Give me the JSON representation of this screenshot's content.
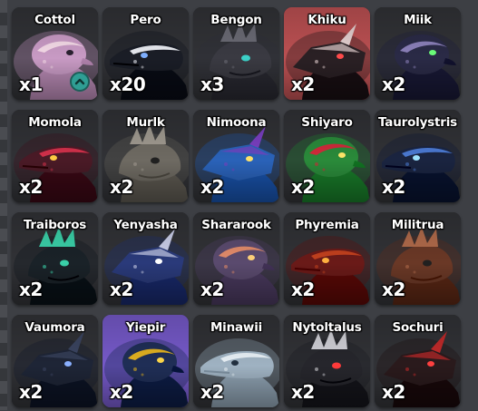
{
  "inventory": {
    "items": [
      {
        "name": "Cottol",
        "qty": "x1",
        "icon": "cottol-portrait-icon",
        "bg": "#2b2c30",
        "body": "#c89ac4",
        "accent": "#f3d9e6",
        "eye": "#2a2030",
        "badge": "upgrade-badge-icon"
      },
      {
        "name": "Pero",
        "qty": "x20",
        "icon": "pero-portrait-icon",
        "bg": "#2b2c30",
        "body": "#1a1d26",
        "accent": "#e6e8ee",
        "eye": "#7fb0ff"
      },
      {
        "name": "Bengon",
        "qty": "x3",
        "icon": "bengon-portrait-icon",
        "bg": "#2b2c30",
        "body": "#3a3a42",
        "accent": "#6a6a74",
        "eye": "#3cd1c8"
      },
      {
        "name": "Khiku",
        "qty": "x2",
        "icon": "khiku-portrait-icon",
        "bg": "#b54a4c",
        "body": "#2a2024",
        "accent": "#e4d0d0",
        "eye": "#ff4a4a"
      },
      {
        "name": "Miik",
        "qty": "x2",
        "icon": "miik-portrait-icon",
        "bg": "#2b2c30",
        "body": "#2a2a46",
        "accent": "#8a7fb8",
        "eye": "#6bff7a"
      },
      {
        "name": "Momola",
        "qty": "x2",
        "icon": "momola-portrait-icon",
        "bg": "#2b2c30",
        "body": "#4a1a26",
        "accent": "#d0304a",
        "eye": "#ffcc44"
      },
      {
        "name": "Murlk",
        "qty": "x2",
        "icon": "murlk-portrait-icon",
        "bg": "#2b2c30",
        "body": "#6e6a62",
        "accent": "#a09a90",
        "eye": "#202020"
      },
      {
        "name": "Nimoona",
        "qty": "x2",
        "icon": "nimoona-portrait-icon",
        "bg": "#2b2c30",
        "body": "#2a62b8",
        "accent": "#7a3fc0",
        "eye": "#ffe36a"
      },
      {
        "name": "Shiyaro",
        "qty": "x2",
        "icon": "shiyaro-portrait-icon",
        "bg": "#2b2c30",
        "body": "#2a8a3a",
        "accent": "#d02a3a",
        "eye": "#ffe66a"
      },
      {
        "name": "Taurolystris",
        "qty": "x2",
        "icon": "taurolystris-portrait-icon",
        "bg": "#2b2c30",
        "body": "#1a2440",
        "accent": "#4a78d0",
        "eye": "#9fe3ff"
      },
      {
        "name": "Traiboros",
        "qty": "x2",
        "icon": "traiboros-portrait-icon",
        "bg": "#2b2c30",
        "body": "#1a2228",
        "accent": "#3ad0a8",
        "eye": "#3ad0a8"
      },
      {
        "name": "Yenyasha",
        "qty": "x2",
        "icon": "yenyasha-portrait-icon",
        "bg": "#2b2c30",
        "body": "#2a3a7a",
        "accent": "#c9cde8",
        "eye": "#ffffff"
      },
      {
        "name": "Shararook",
        "qty": "x2",
        "icon": "shararook-portrait-icon",
        "bg": "#2b2c30",
        "body": "#5a4a6e",
        "accent": "#e08a6a",
        "eye": "#ffd27a"
      },
      {
        "name": "Phyremia",
        "qty": "x2",
        "icon": "phyremia-portrait-icon",
        "bg": "#2b2c30",
        "body": "#6a1a18",
        "accent": "#c0401e",
        "eye": "#ffb040"
      },
      {
        "name": "Militrua",
        "qty": "x2",
        "icon": "militrua-portrait-icon",
        "bg": "#2b2c30",
        "body": "#6a3826",
        "accent": "#b06a4a",
        "eye": "#202020"
      },
      {
        "name": "Vaumora",
        "qty": "x2",
        "icon": "vaumora-portrait-icon",
        "bg": "#2b2c30",
        "body": "#1e2536",
        "accent": "#3a4460",
        "eye": "#8ab0ff"
      },
      {
        "name": "Yiepir",
        "qty": "x2",
        "icon": "yiepir-portrait-icon",
        "bg": "#6f53c2",
        "body": "#1f2e56",
        "accent": "#e0b020",
        "eye": "#ffd84a"
      },
      {
        "name": "Minawii",
        "qty": "x2",
        "icon": "minawii-portrait-icon",
        "bg": "#2b2c30",
        "body": "#9fb2c2",
        "accent": "#e6eef4",
        "eye": "#223040"
      },
      {
        "name": "Nytoltalus",
        "qty": "x2",
        "icon": "nytoltalus-portrait-icon",
        "bg": "#2b2c30",
        "body": "#26262c",
        "accent": "#d0d0d6",
        "eye": "#ff3a3a"
      },
      {
        "name": "Sochuri",
        "qty": "x2",
        "icon": "sochuri-portrait-icon",
        "bg": "#2b2c30",
        "body": "#2a1a1c",
        "accent": "#c02a2a",
        "eye": "#ff4040"
      }
    ]
  }
}
